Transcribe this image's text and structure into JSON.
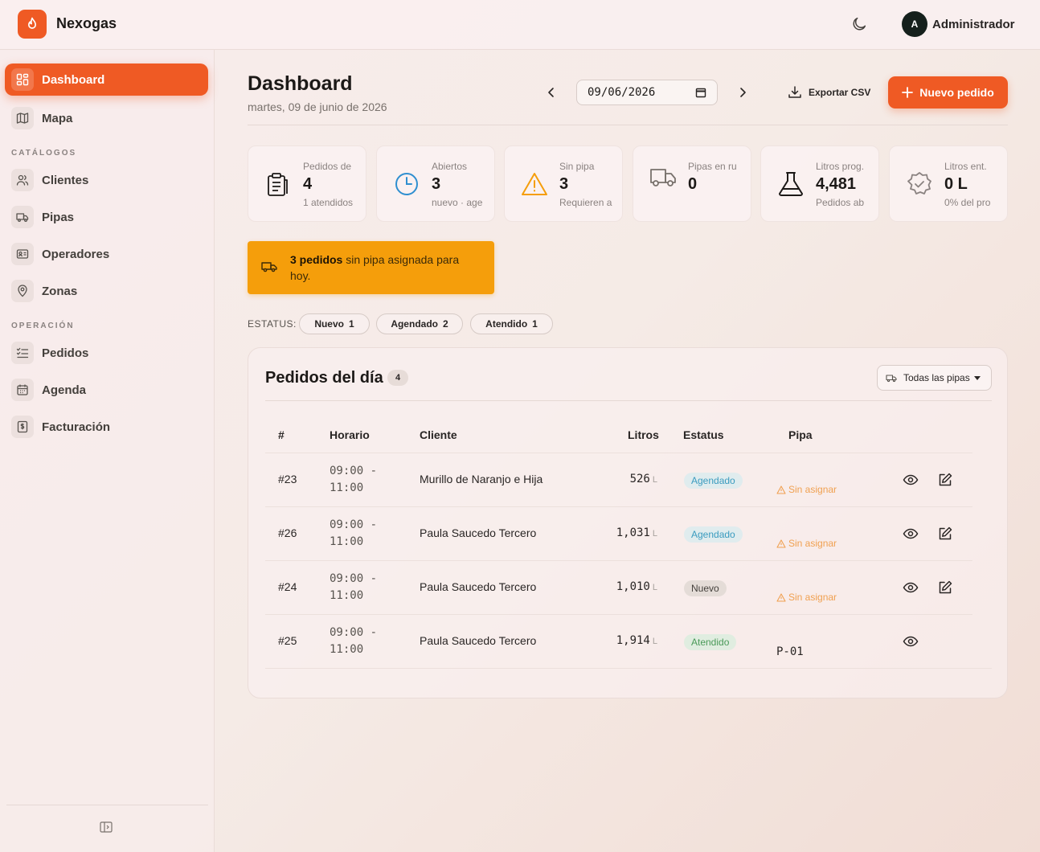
{
  "app": {
    "name": "Nexogas"
  },
  "user": {
    "initial": "A",
    "name": "Administrador"
  },
  "sidebar": {
    "main": [
      {
        "label": "Dashboard"
      },
      {
        "label": "Mapa"
      }
    ],
    "catalogos_label": "CATÁLOGOS",
    "catalogos": [
      {
        "label": "Clientes"
      },
      {
        "label": "Pipas"
      },
      {
        "label": "Operadores"
      },
      {
        "label": "Zonas"
      }
    ],
    "operacion_label": "OPERACIÓN",
    "operacion": [
      {
        "label": "Pedidos"
      },
      {
        "label": "Agenda"
      },
      {
        "label": "Facturación"
      }
    ]
  },
  "header": {
    "title": "Dashboard",
    "date_text": "martes, 09 de junio de 2026",
    "date_value": "09/06/2026",
    "export_label": "Exportar CSV",
    "new_label": "Nuevo pedido"
  },
  "stats": [
    {
      "title": "Pedidos de",
      "value": "4",
      "sub": "1 atendidos",
      "icon": "clipboard-icon"
    },
    {
      "title": "Abiertos",
      "value": "3",
      "sub": "nuevo · age",
      "icon": "clock-icon"
    },
    {
      "title": "Sin pipa",
      "value": "3",
      "sub": "Requieren a",
      "icon": "warning-icon"
    },
    {
      "title": "Pipas en ru",
      "value": "0",
      "sub": "",
      "icon": "truck-icon"
    },
    {
      "title": "Litros prog.",
      "value": "4,481",
      "sub": "Pedidos ab",
      "icon": "flask-icon"
    },
    {
      "title": "Litros ent.",
      "value": "0 L",
      "sub": "0% del pro",
      "icon": "badge-check-icon"
    }
  ],
  "alert": {
    "bold": "3 pedidos",
    "text": " sin pipa asignada para hoy."
  },
  "status_filter": {
    "label": "ESTATUS:",
    "chips": [
      {
        "label": "Nuevo",
        "count": "1"
      },
      {
        "label": "Agendado",
        "count": "2"
      },
      {
        "label": "Atendido",
        "count": "1"
      }
    ]
  },
  "orders": {
    "title": "Pedidos del día",
    "count": "4",
    "pipa_filter": "Todas las pipas",
    "columns": [
      "#",
      "Horario",
      "Cliente",
      "Litros",
      "Estatus",
      "Pipa"
    ],
    "unit": "L",
    "unassigned_label": "Sin asignar",
    "rows": [
      {
        "id": "#23",
        "time": "09:00 - 11:00",
        "client": "Murillo de Naranjo e Hija",
        "liters": "526",
        "status": "Agendado",
        "pipa": ""
      },
      {
        "id": "#26",
        "time": "09:00 - 11:00",
        "client": "Paula Saucedo Tercero",
        "liters": "1,031",
        "status": "Agendado",
        "pipa": ""
      },
      {
        "id": "#24",
        "time": "09:00 - 11:00",
        "client": "Paula Saucedo Tercero",
        "liters": "1,010",
        "status": "Nuevo",
        "pipa": ""
      },
      {
        "id": "#25",
        "time": "09:00 - 11:00",
        "client": "Paula Saucedo Tercero",
        "liters": "1,914",
        "status": "Atendido",
        "pipa": "P-01"
      }
    ]
  },
  "colors": {
    "accent": "#ef5a24",
    "alert": "#f59e0b",
    "agendado": "#3a9bbf",
    "atendido": "#4a9a59",
    "warning": "#f0a050"
  }
}
